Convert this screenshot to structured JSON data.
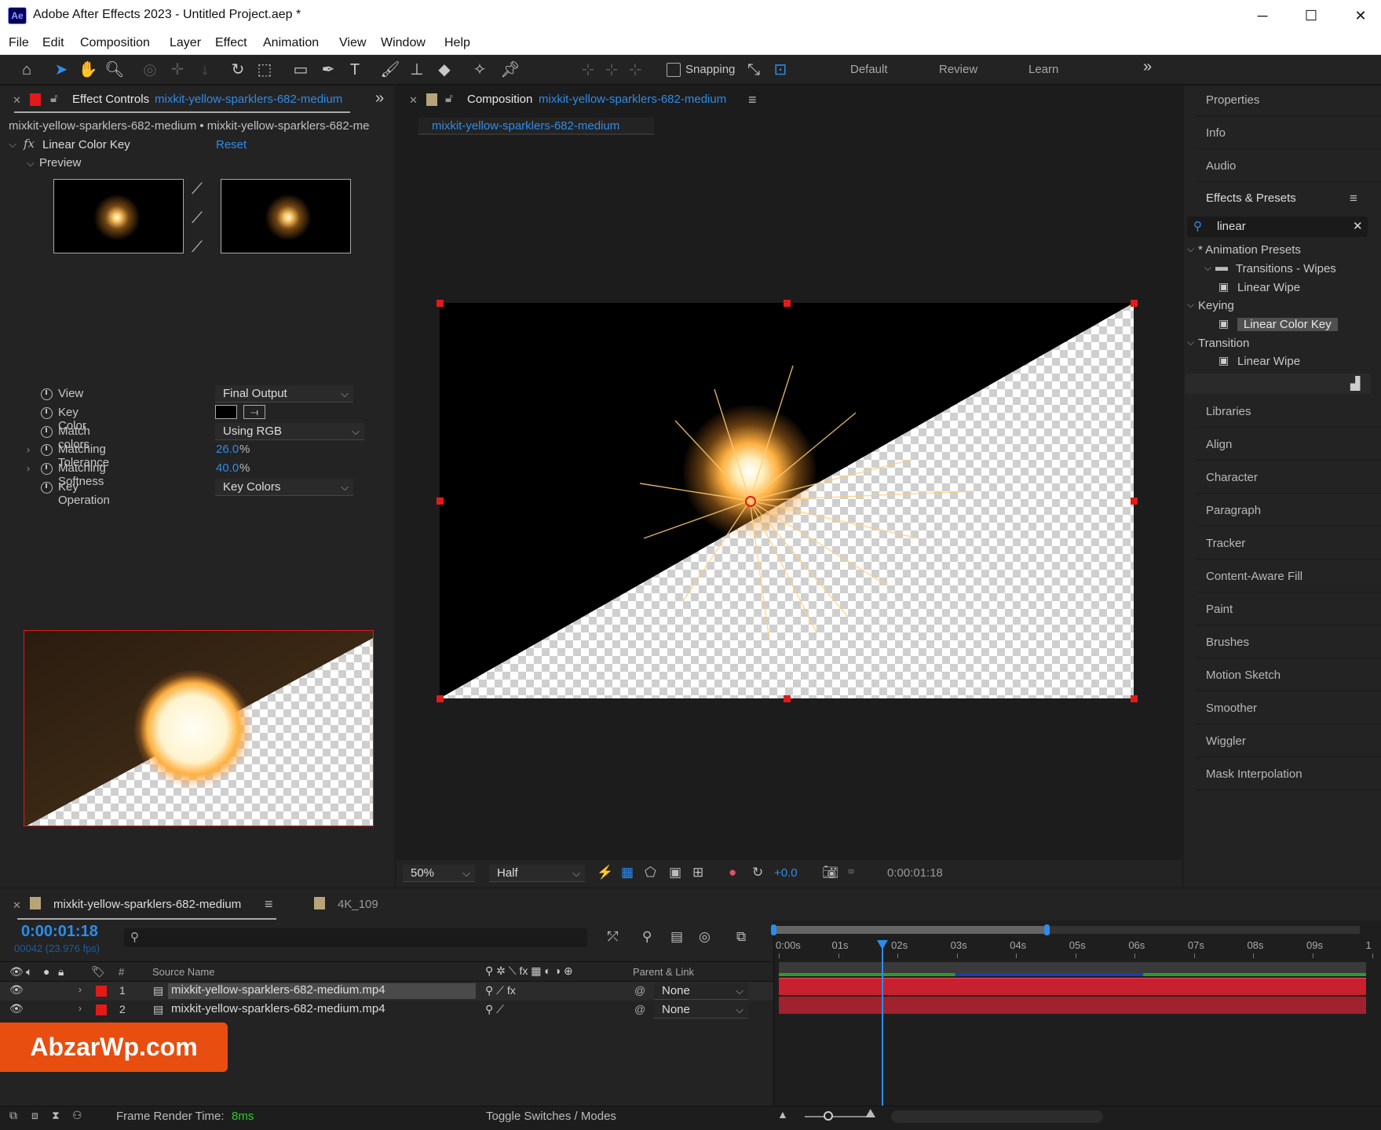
{
  "window": {
    "title": "Adobe After Effects 2023 - Untitled Project.aep *",
    "logo": "Ae",
    "minimize": "─",
    "maximize": "☐",
    "close": "✕"
  },
  "menu": [
    "File",
    "Edit",
    "Composition",
    "Layer",
    "Effect",
    "Animation",
    "View",
    "Window",
    "Help"
  ],
  "toolbar": {
    "snapping_label": "Snapping",
    "workspaces": [
      "Default",
      "Review",
      "Learn"
    ],
    "more": "»"
  },
  "effect_controls": {
    "tab_label": "Effect Controls",
    "tab_source": "mixkit-yellow-sparklers-682-medium",
    "breadcrumb": "mixkit-yellow-sparklers-682-medium • mixkit-yellow-sparklers-682-me",
    "effect_name": "Linear Color Key",
    "reset": "Reset",
    "preview_label": "Preview",
    "props": [
      {
        "label": "View",
        "value": "Final Output",
        "type": "dropdown"
      },
      {
        "label": "Key Color",
        "value": "",
        "type": "color"
      },
      {
        "label": "Match colors",
        "value": "Using RGB",
        "type": "dropdown"
      },
      {
        "label": "Matching Tolerance",
        "value": "26.0",
        "unit": "%",
        "type": "number"
      },
      {
        "label": "Matching Softness",
        "value": "40.0",
        "unit": "%",
        "type": "number"
      },
      {
        "label": "Key Operation",
        "value": "Key Colors",
        "type": "dropdown"
      }
    ]
  },
  "composition": {
    "tab_label": "Composition",
    "tab_source": "mixkit-yellow-sparklers-682-medium",
    "sub_tab": "mixkit-yellow-sparklers-682-medium",
    "zoom": "50%",
    "resolution": "Half",
    "exposure": "+0.0",
    "timecode": "0:00:01:18"
  },
  "right_panel": {
    "items_top": [
      "Properties",
      "Info",
      "Audio"
    ],
    "effects_presets_title": "Effects & Presets",
    "search_value": "linear",
    "tree": [
      {
        "label": "* Animation Presets",
        "level": 0
      },
      {
        "label": "Transitions - Wipes",
        "level": 1
      },
      {
        "label": "Linear Wipe",
        "level": 2
      },
      {
        "label": "Keying",
        "level": 0
      },
      {
        "label": "Linear Color Key",
        "level": 2,
        "selected": true
      },
      {
        "label": "Transition",
        "level": 0
      },
      {
        "label": "Linear Wipe",
        "level": 2
      }
    ],
    "items_bottom": [
      "Libraries",
      "Align",
      "Character",
      "Paragraph",
      "Tracker",
      "Content-Aware Fill",
      "Paint",
      "Brushes",
      "Motion Sketch",
      "Smoother",
      "Wiggler",
      "Mask Interpolation"
    ]
  },
  "timeline": {
    "tab_label": "mixkit-yellow-sparklers-682-medium",
    "tab2_label": "4K_109",
    "timecode": "0:00:01:18",
    "frame_info": "00042 (23.976 fps)",
    "col_num": "#",
    "col_source": "Source Name",
    "col_parent": "Parent & Link",
    "ruler": [
      "0:00s",
      "01s",
      "02s",
      "03s",
      "04s",
      "05s",
      "06s",
      "07s",
      "08s",
      "09s",
      "1"
    ],
    "layers": [
      {
        "num": "1",
        "name": "mixkit-yellow-sparklers-682-medium.mp4",
        "parent": "None"
      },
      {
        "num": "2",
        "name": "mixkit-yellow-sparklers-682-medium.mp4",
        "parent": "None"
      }
    ],
    "playhead_fraction": 0.175
  },
  "status_bar": {
    "render_label": "Frame Render Time:",
    "render_value": "8ms",
    "toggle": "Toggle Switches / Modes"
  },
  "watermark": "AbzarWp.com",
  "colors": {
    "accent": "#2d8ceb",
    "label_red": "#e21a1a",
    "clip_red": "#c8202e"
  }
}
